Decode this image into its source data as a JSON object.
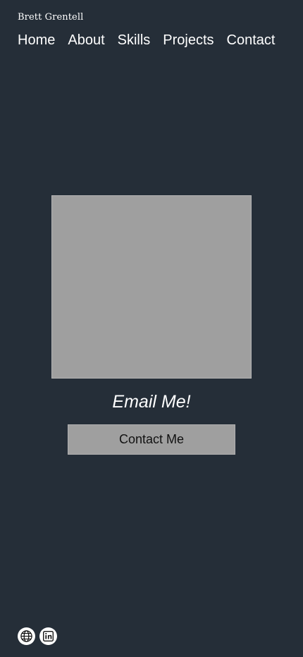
{
  "brand": {
    "name": "Brett Grentell"
  },
  "nav": {
    "items": [
      {
        "label": "Home"
      },
      {
        "label": "About"
      },
      {
        "label": "Skills"
      },
      {
        "label": "Projects"
      },
      {
        "label": "Contact"
      }
    ]
  },
  "contact": {
    "heading": "Email Me!",
    "button_label": "Contact Me"
  },
  "social": {
    "icons": [
      "globe-icon",
      "linkedin-icon"
    ]
  },
  "colors": {
    "background": "#252e38",
    "placeholder": "#9f9f9f",
    "text": "#ffffff"
  }
}
